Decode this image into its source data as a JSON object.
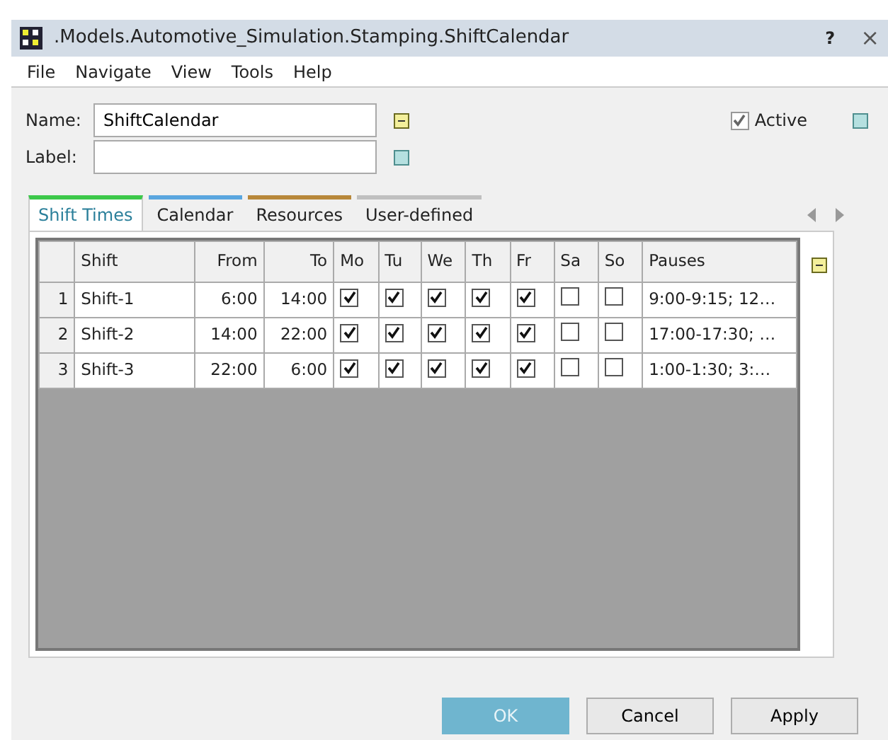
{
  "window": {
    "title": ".Models.Automotive_Simulation.Stamping.ShiftCalendar",
    "help": "?",
    "close": "×"
  },
  "menu": [
    "File",
    "Navigate",
    "View",
    "Tools",
    "Help"
  ],
  "fields": [
    {
      "label": "Name:",
      "value": "ShiftCalendar",
      "kind": "minus"
    },
    {
      "label": "Label:",
      "kind": "plain"
    }
  ],
  "active": {
    "label": "Active",
    "checked": true
  },
  "tabs": [
    {
      "label": "Shift Times",
      "selected": true,
      "color": "#3cc84a"
    },
    {
      "label": "Calendar",
      "selected": false,
      "color": "#5aa6df"
    },
    {
      "label": "Resources",
      "selected": false,
      "color": "#b8883a"
    },
    {
      "label": "User-defined",
      "selected": false,
      "color": "#c0c0c0"
    }
  ],
  "table": {
    "columns": [
      "Shift",
      "From",
      "To",
      "Mo",
      "Tu",
      "We",
      "Th",
      "Fr",
      "Sa",
      "So",
      "Pauses"
    ],
    "rows": [
      {
        "index": "1",
        "shift": "Shift-1",
        "from": "6:00",
        "to": "14:00",
        "days": [
          true,
          true,
          true,
          true,
          true,
          false,
          false
        ],
        "pauses": "9:00-9:15; 12…"
      },
      {
        "index": "2",
        "shift": "Shift-2",
        "from": "14:00",
        "to": "22:00",
        "days": [
          true,
          true,
          true,
          true,
          true,
          false,
          false
        ],
        "pauses": "17:00-17:30; …"
      },
      {
        "index": "3",
        "shift": "Shift-3",
        "from": "22:00",
        "to": "6:00",
        "days": [
          true,
          true,
          true,
          true,
          true,
          false,
          false
        ],
        "pauses": "1:00-1:30; 3:…"
      }
    ]
  },
  "buttons": [
    {
      "label": "OK",
      "default": true
    },
    {
      "label": "Cancel",
      "default": false
    },
    {
      "label": "Apply",
      "default": false
    }
  ]
}
